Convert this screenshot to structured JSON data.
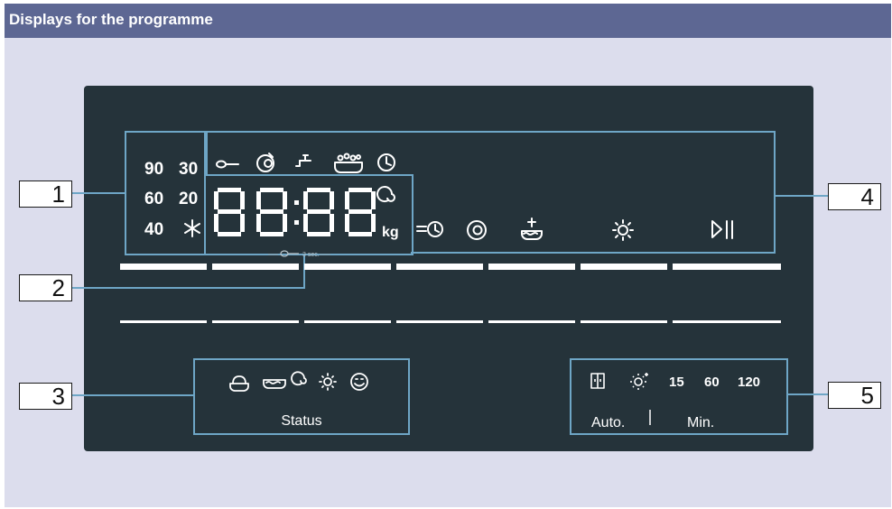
{
  "header": {
    "title": "Displays for the programme"
  },
  "callouts": [
    "1",
    "2",
    "3",
    "4",
    "5"
  ],
  "temperatures": {
    "t90": "90",
    "t30": "30",
    "t60": "60",
    "t20": "20",
    "t40": "40"
  },
  "display": {
    "unit": "kg",
    "lock_hint": "3 sec."
  },
  "status": {
    "label": "Status"
  },
  "options": {
    "v15": "15",
    "v60": "60",
    "v120": "120",
    "auto": "Auto.",
    "min": "Min."
  },
  "colors": {
    "background": "#dcdded",
    "header": "#5d6793",
    "panel": "#25333a",
    "highlight": "#6ea6c6",
    "icons": "#ffffff"
  }
}
